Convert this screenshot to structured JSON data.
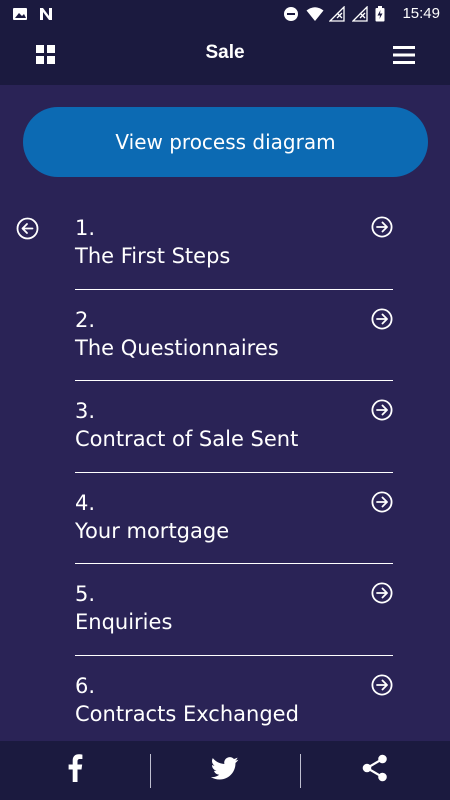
{
  "status_bar": {
    "time": "15:49",
    "left_icons": [
      "image-icon",
      "n-notification-icon"
    ],
    "right_icons": [
      "do-not-disturb-icon",
      "wifi-icon",
      "signal-off-icon",
      "signal-off-icon",
      "battery-charging-icon"
    ]
  },
  "header": {
    "title": "Sale",
    "left_icon": "grid-icon",
    "right_icon": "menu-icon"
  },
  "cta": {
    "label": "View process diagram"
  },
  "back": {
    "icon": "back-arrow-icon"
  },
  "steps": [
    {
      "number": "1.",
      "title": "The First Steps"
    },
    {
      "number": "2.",
      "title": "The Questionnaires"
    },
    {
      "number": "3.",
      "title": "Contract of Sale Sent"
    },
    {
      "number": "4.",
      "title": "Your mortgage"
    },
    {
      "number": "5.",
      "title": "Enquiries"
    },
    {
      "number": "6.",
      "title": "Contracts Exchanged"
    }
  ],
  "bottom_bar": {
    "items": [
      "facebook-icon",
      "twitter-icon",
      "share-icon"
    ]
  },
  "colors": {
    "background": "#2a2356",
    "bars": "#1b1a3f",
    "accent": "#0c6ab3",
    "text": "#ffffff"
  }
}
